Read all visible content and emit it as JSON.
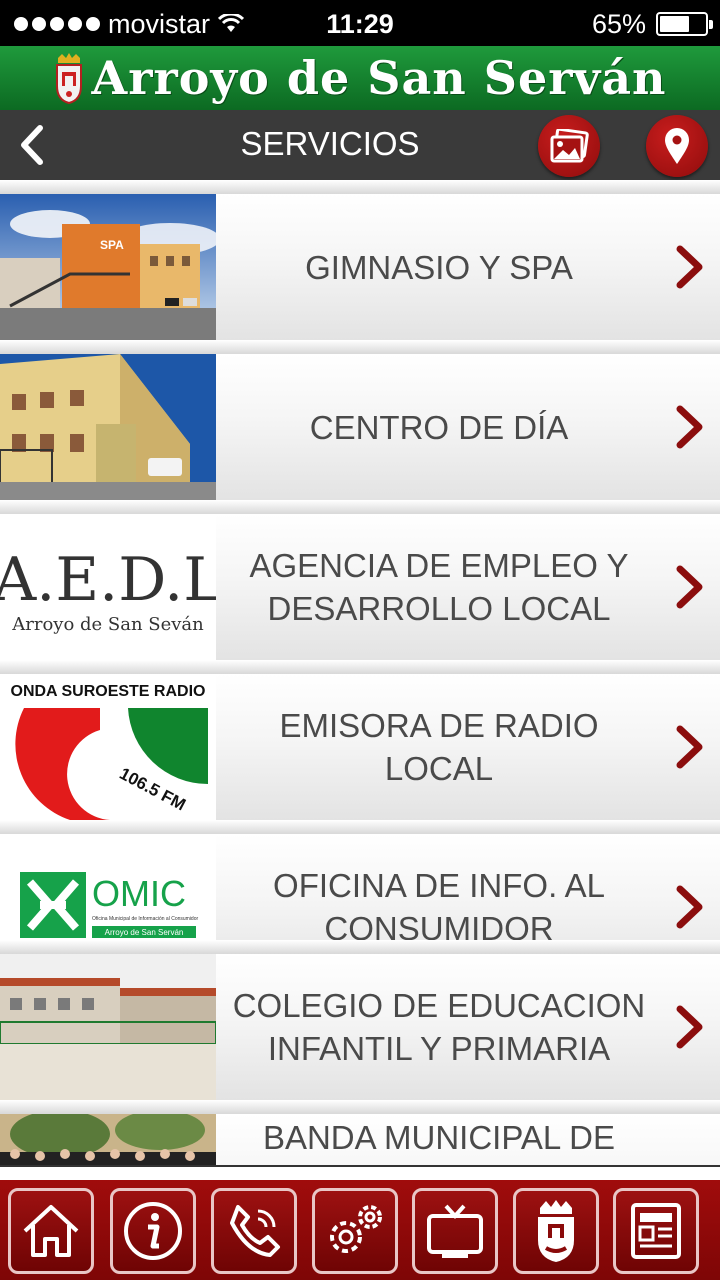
{
  "status_bar": {
    "carrier": "movistar",
    "time": "11:29",
    "battery_percent_label": "65%",
    "battery_level": 0.65
  },
  "banner": {
    "title": "Arroyo de San Serván"
  },
  "nav": {
    "title": "SERVICIOS"
  },
  "services": [
    {
      "label": "GIMNASIO Y SPA",
      "thumb_text": "SPA"
    },
    {
      "label": "CENTRO DE DÍA"
    },
    {
      "label": "AGENCIA DE EMPLEO Y DESARROLLO LOCAL",
      "logo_title": "A.E.D.L",
      "logo_subtitle": "Arroyo de San Seván"
    },
    {
      "label": "EMISORA DE RADIO LOCAL",
      "logo_title": "ONDA SUROESTE RADIO",
      "logo_freq": "106.5 FM"
    },
    {
      "label": "OFICINA DE INFO. AL CONSUMIDOR",
      "logo_title": "OMIC",
      "logo_subtitle": "Oficina Municipal de Información al Consumidor",
      "logo_town": "Arroyo de San Serván"
    },
    {
      "label": "COLEGIO DE EDUCACION INFANTIL Y PRIMARIA"
    },
    {
      "label": "BANDA MUNICIPAL DE"
    }
  ],
  "tab_icons": [
    "home-icon",
    "info-icon",
    "phone-icon",
    "settings-icon",
    "tv-icon",
    "coat-of-arms-icon",
    "news-icon"
  ],
  "colors": {
    "brand_green": "#0c6a22",
    "brand_red": "#8f0c0c",
    "nav_bg": "#3a3a3a",
    "chevron": "#8b0d0d"
  }
}
